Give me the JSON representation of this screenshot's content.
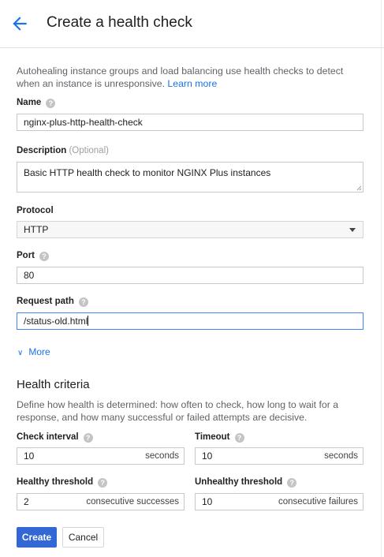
{
  "header": {
    "title": "Create a health check"
  },
  "intro": {
    "text": "Autohealing instance groups and load balancing use health checks to detect when an instance is unresponsive.",
    "link": "Learn more"
  },
  "form": {
    "name": {
      "label": "Name",
      "value": "nginx-plus-http-health-check"
    },
    "description": {
      "label": "Description",
      "optional": "(Optional)",
      "value": "Basic HTTP health check to monitor NGINX Plus instances"
    },
    "protocol": {
      "label": "Protocol",
      "value": "HTTP"
    },
    "port": {
      "label": "Port",
      "value": "80"
    },
    "request_path": {
      "label": "Request path",
      "value": "/status-old.html"
    },
    "more": "More"
  },
  "criteria": {
    "title": "Health criteria",
    "description": "Define how health is determined: how often to check, how long to wait for a response, and how many successful or failed attempts are decisive.",
    "check_interval": {
      "label": "Check interval",
      "value": "10",
      "unit": "seconds"
    },
    "timeout": {
      "label": "Timeout",
      "value": "10",
      "unit": "seconds"
    },
    "healthy_threshold": {
      "label": "Healthy threshold",
      "value": "2",
      "unit": "consecutive successes"
    },
    "unhealthy_threshold": {
      "label": "Unhealthy threshold",
      "value": "10",
      "unit": "consecutive failures"
    }
  },
  "actions": {
    "create": "Create",
    "cancel": "Cancel"
  },
  "help_glyph": "?",
  "colors": {
    "primary": "#3367d6",
    "link": "#1a73e8",
    "focus": "#4285f4"
  }
}
